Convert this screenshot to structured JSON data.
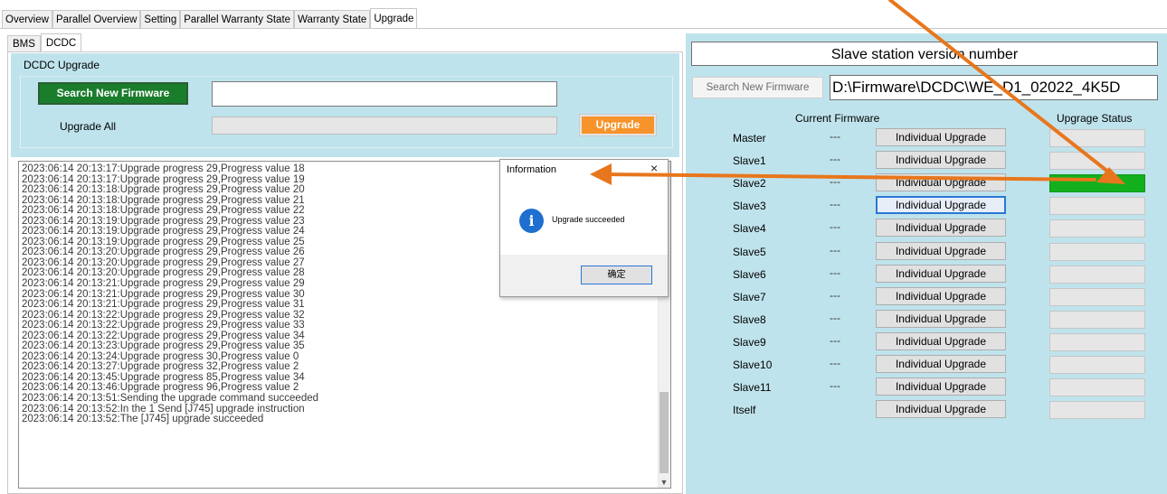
{
  "top_tabs": [
    "Overview",
    "Parallel Overview",
    "Setting",
    "Parallel Warranty State",
    "Warranty State",
    "Upgrade"
  ],
  "sub_tabs": [
    "BMS",
    "DCDC"
  ],
  "left": {
    "group_label": "DCDC Upgrade",
    "search_button": "Search New Firmware",
    "firmware_path": "",
    "upgrade_all_label": "Upgrade All",
    "upgrade_button": "Upgrade",
    "log": [
      "2023:06:14 20:13:17:Upgrade progress 29,Progress value 18",
      "2023:06:14 20:13:17:Upgrade progress 29,Progress value 19",
      "2023:06:14 20:13:18:Upgrade progress 29,Progress value 20",
      "2023:06:14 20:13:18:Upgrade progress 29,Progress value 21",
      "2023:06:14 20:13:18:Upgrade progress 29,Progress value 22",
      "2023:06:14 20:13:19:Upgrade progress 29,Progress value 23",
      "2023:06:14 20:13:19:Upgrade progress 29,Progress value 24",
      "2023:06:14 20:13:19:Upgrade progress 29,Progress value 25",
      "2023:06:14 20:13:20:Upgrade progress 29,Progress value 26",
      "2023:06:14 20:13:20:Upgrade progress 29,Progress value 27",
      "2023:06:14 20:13:20:Upgrade progress 29,Progress value 28",
      "2023:06:14 20:13:21:Upgrade progress 29,Progress value 29",
      "2023:06:14 20:13:21:Upgrade progress 29,Progress value 30",
      "2023:06:14 20:13:21:Upgrade progress 29,Progress value 31",
      "2023:06:14 20:13:22:Upgrade progress 29,Progress value 32",
      "2023:06:14 20:13:22:Upgrade progress 29,Progress value 33",
      "2023:06:14 20:13:22:Upgrade progress 29,Progress value 34",
      "2023:06:14 20:13:23:Upgrade progress 29,Progress value 35",
      "2023:06:14 20:13:24:Upgrade progress 30,Progress value 0",
      "2023:06:14 20:13:27:Upgrade progress 32,Progress value 2",
      "2023:06:14 20:13:45:Upgrade progress 85,Progress value 34",
      "2023:06:14 20:13:46:Upgrade progress 96,Progress value 2",
      "2023:06:14 20:13:51:Sending the upgrade command succeeded",
      "2023:06:14 20:13:52:In the 1 Send [J745] upgrade instruction",
      "2023:06:14 20:13:52:The [J745] upgrade succeeded"
    ]
  },
  "right": {
    "title": "Slave station version number",
    "search_button": "Search New Firmware",
    "firmware_path": "D:\\Firmware\\DCDC\\WE_D1_02022_4K5D",
    "col_current_firmware": "Current Firmware",
    "col_upgrade_status": "Upgrage Status",
    "individual_upgrade_label": "Individual Upgrade",
    "rows": [
      {
        "label": "Master",
        "firmware": "---",
        "status": "empty"
      },
      {
        "label": "Slave1",
        "firmware": "---",
        "status": "empty"
      },
      {
        "label": "Slave2",
        "firmware": "---",
        "status": "done"
      },
      {
        "label": "Slave3",
        "firmware": "---",
        "status": "empty"
      },
      {
        "label": "Slave4",
        "firmware": "---",
        "status": "empty"
      },
      {
        "label": "Slave5",
        "firmware": "---",
        "status": "empty"
      },
      {
        "label": "Slave6",
        "firmware": "---",
        "status": "empty"
      },
      {
        "label": "Slave7",
        "firmware": "---",
        "status": "empty"
      },
      {
        "label": "Slave8",
        "firmware": "---",
        "status": "empty"
      },
      {
        "label": "Slave9",
        "firmware": "---",
        "status": "empty"
      },
      {
        "label": "Slave10",
        "firmware": "---",
        "status": "empty"
      },
      {
        "label": "Slave11",
        "firmware": "---",
        "status": "empty"
      },
      {
        "label": "Itself",
        "firmware": "",
        "status": "empty"
      }
    ]
  },
  "dialog": {
    "title": "Information",
    "close": "×",
    "icon": "i",
    "message": "Upgrade succeeded",
    "ok_button": "确定"
  },
  "colors": {
    "panel": "#bfe3ec",
    "search_button": "#1a7d2c",
    "upgrade_button": "#f7932b",
    "status_done": "#13b01e",
    "annotation_arrow": "#e8761c"
  }
}
